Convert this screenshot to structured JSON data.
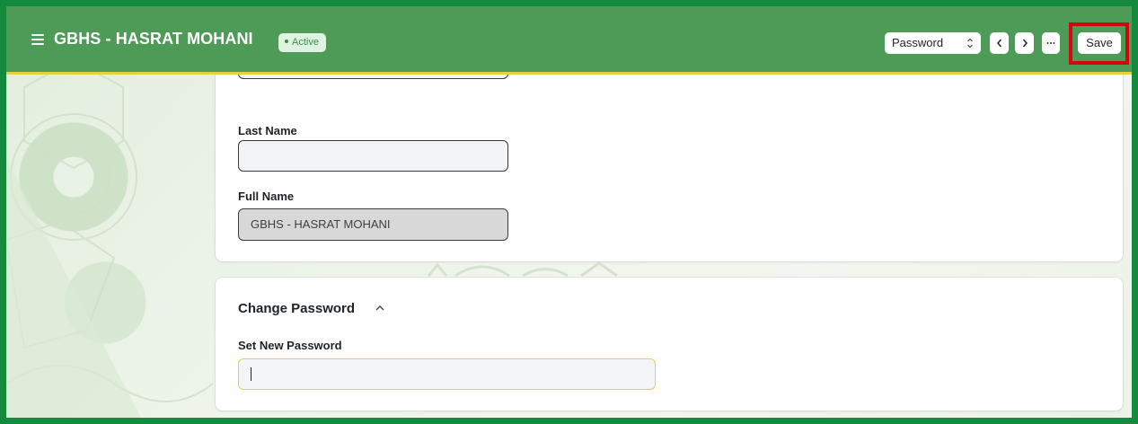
{
  "header": {
    "menu_icon": "hamburger-icon",
    "title": "GBHS - HASRAT MOHANI",
    "status": "Active",
    "colors": {
      "bar": "#4e9a57",
      "accent_line": "#e7cf3d",
      "frame": "#138a3e",
      "highlight": "#d2080f"
    }
  },
  "toolbar": {
    "select_value": "Password",
    "select_icon": "sort-caret-icon",
    "prev_icon": "chevron-left-icon",
    "next_icon": "chevron-right-icon",
    "more_icon": "ellipsis-icon",
    "save_label": "Save"
  },
  "form": {
    "first_name_value": "",
    "last_name_label": "Last Name",
    "last_name_value": "",
    "full_name_label": "Full Name",
    "full_name_value": "GBHS - HASRAT MOHANI"
  },
  "change_password": {
    "section_title": "Change Password",
    "collapse_icon": "chevron-up-icon",
    "new_password_label": "Set New Password",
    "new_password_value": ""
  }
}
